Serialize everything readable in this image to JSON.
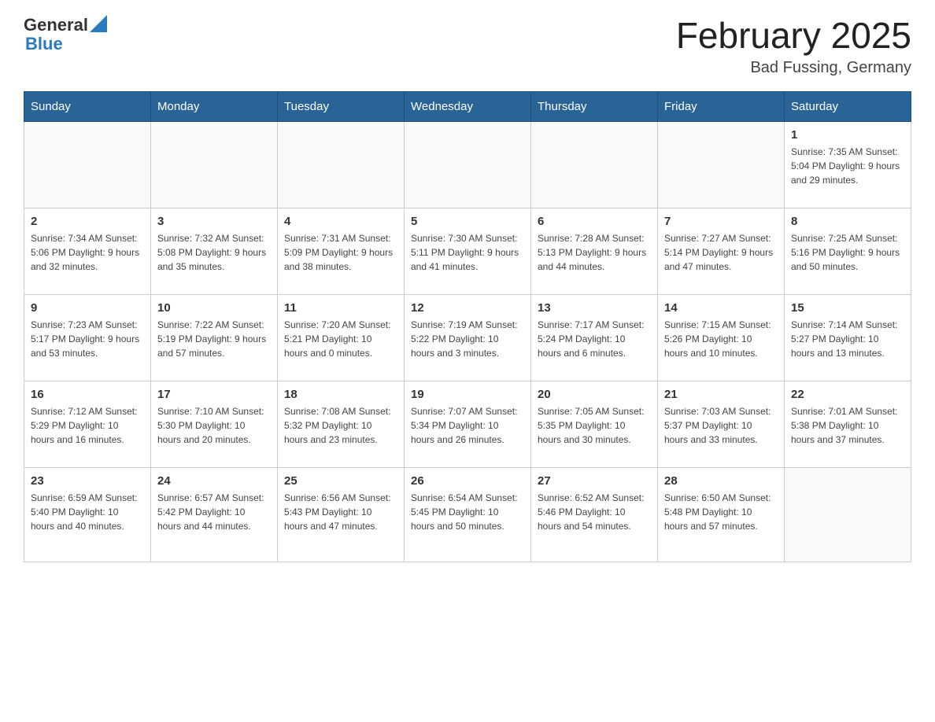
{
  "header": {
    "logo_general": "General",
    "logo_blue": "Blue",
    "title": "February 2025",
    "subtitle": "Bad Fussing, Germany"
  },
  "weekdays": [
    "Sunday",
    "Monday",
    "Tuesday",
    "Wednesday",
    "Thursday",
    "Friday",
    "Saturday"
  ],
  "weeks": [
    [
      {
        "day": "",
        "info": ""
      },
      {
        "day": "",
        "info": ""
      },
      {
        "day": "",
        "info": ""
      },
      {
        "day": "",
        "info": ""
      },
      {
        "day": "",
        "info": ""
      },
      {
        "day": "",
        "info": ""
      },
      {
        "day": "1",
        "info": "Sunrise: 7:35 AM\nSunset: 5:04 PM\nDaylight: 9 hours and 29 minutes."
      }
    ],
    [
      {
        "day": "2",
        "info": "Sunrise: 7:34 AM\nSunset: 5:06 PM\nDaylight: 9 hours and 32 minutes."
      },
      {
        "day": "3",
        "info": "Sunrise: 7:32 AM\nSunset: 5:08 PM\nDaylight: 9 hours and 35 minutes."
      },
      {
        "day": "4",
        "info": "Sunrise: 7:31 AM\nSunset: 5:09 PM\nDaylight: 9 hours and 38 minutes."
      },
      {
        "day": "5",
        "info": "Sunrise: 7:30 AM\nSunset: 5:11 PM\nDaylight: 9 hours and 41 minutes."
      },
      {
        "day": "6",
        "info": "Sunrise: 7:28 AM\nSunset: 5:13 PM\nDaylight: 9 hours and 44 minutes."
      },
      {
        "day": "7",
        "info": "Sunrise: 7:27 AM\nSunset: 5:14 PM\nDaylight: 9 hours and 47 minutes."
      },
      {
        "day": "8",
        "info": "Sunrise: 7:25 AM\nSunset: 5:16 PM\nDaylight: 9 hours and 50 minutes."
      }
    ],
    [
      {
        "day": "9",
        "info": "Sunrise: 7:23 AM\nSunset: 5:17 PM\nDaylight: 9 hours and 53 minutes."
      },
      {
        "day": "10",
        "info": "Sunrise: 7:22 AM\nSunset: 5:19 PM\nDaylight: 9 hours and 57 minutes."
      },
      {
        "day": "11",
        "info": "Sunrise: 7:20 AM\nSunset: 5:21 PM\nDaylight: 10 hours and 0 minutes."
      },
      {
        "day": "12",
        "info": "Sunrise: 7:19 AM\nSunset: 5:22 PM\nDaylight: 10 hours and 3 minutes."
      },
      {
        "day": "13",
        "info": "Sunrise: 7:17 AM\nSunset: 5:24 PM\nDaylight: 10 hours and 6 minutes."
      },
      {
        "day": "14",
        "info": "Sunrise: 7:15 AM\nSunset: 5:26 PM\nDaylight: 10 hours and 10 minutes."
      },
      {
        "day": "15",
        "info": "Sunrise: 7:14 AM\nSunset: 5:27 PM\nDaylight: 10 hours and 13 minutes."
      }
    ],
    [
      {
        "day": "16",
        "info": "Sunrise: 7:12 AM\nSunset: 5:29 PM\nDaylight: 10 hours and 16 minutes."
      },
      {
        "day": "17",
        "info": "Sunrise: 7:10 AM\nSunset: 5:30 PM\nDaylight: 10 hours and 20 minutes."
      },
      {
        "day": "18",
        "info": "Sunrise: 7:08 AM\nSunset: 5:32 PM\nDaylight: 10 hours and 23 minutes."
      },
      {
        "day": "19",
        "info": "Sunrise: 7:07 AM\nSunset: 5:34 PM\nDaylight: 10 hours and 26 minutes."
      },
      {
        "day": "20",
        "info": "Sunrise: 7:05 AM\nSunset: 5:35 PM\nDaylight: 10 hours and 30 minutes."
      },
      {
        "day": "21",
        "info": "Sunrise: 7:03 AM\nSunset: 5:37 PM\nDaylight: 10 hours and 33 minutes."
      },
      {
        "day": "22",
        "info": "Sunrise: 7:01 AM\nSunset: 5:38 PM\nDaylight: 10 hours and 37 minutes."
      }
    ],
    [
      {
        "day": "23",
        "info": "Sunrise: 6:59 AM\nSunset: 5:40 PM\nDaylight: 10 hours and 40 minutes."
      },
      {
        "day": "24",
        "info": "Sunrise: 6:57 AM\nSunset: 5:42 PM\nDaylight: 10 hours and 44 minutes."
      },
      {
        "day": "25",
        "info": "Sunrise: 6:56 AM\nSunset: 5:43 PM\nDaylight: 10 hours and 47 minutes."
      },
      {
        "day": "26",
        "info": "Sunrise: 6:54 AM\nSunset: 5:45 PM\nDaylight: 10 hours and 50 minutes."
      },
      {
        "day": "27",
        "info": "Sunrise: 6:52 AM\nSunset: 5:46 PM\nDaylight: 10 hours and 54 minutes."
      },
      {
        "day": "28",
        "info": "Sunrise: 6:50 AM\nSunset: 5:48 PM\nDaylight: 10 hours and 57 minutes."
      },
      {
        "day": "",
        "info": ""
      }
    ]
  ]
}
